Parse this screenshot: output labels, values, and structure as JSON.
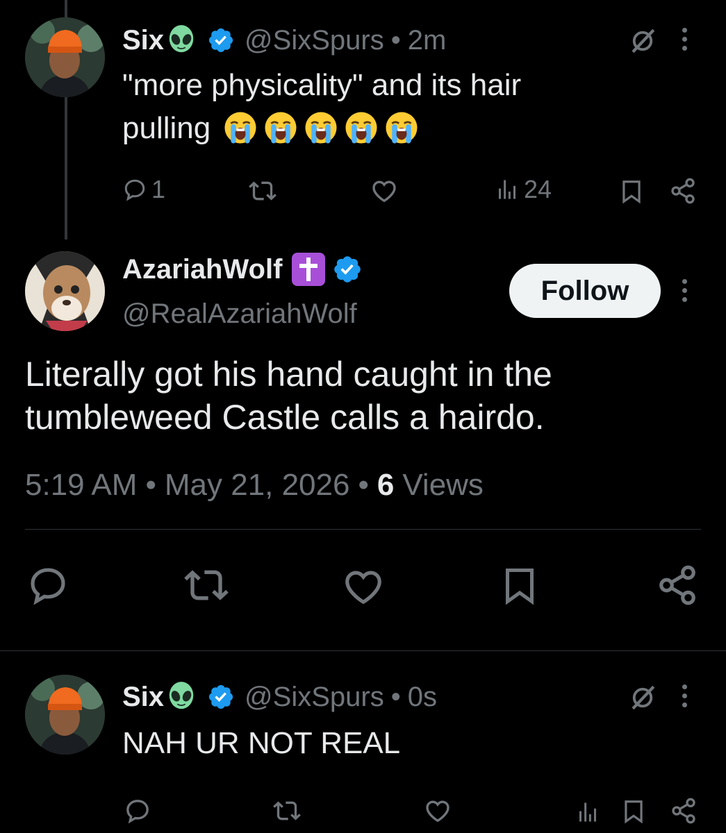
{
  "tweets": [
    {
      "name": "Six",
      "handle": "@SixSpurs",
      "sep": "•",
      "time": "2m",
      "text_line1": "\"more physicality\" and its hair",
      "text_line2": "pulling",
      "emoji_count": 5,
      "replies": "1",
      "views": "24"
    },
    {
      "name": "Six",
      "handle": "@SixSpurs",
      "sep": "•",
      "time": "0s",
      "text": "NAH UR NOT REAL"
    }
  ],
  "main_tweet": {
    "name": "AzariahWolf",
    "handle": "@RealAzariahWolf",
    "follow_label": "Follow",
    "text_line1": "Literally got his hand caught in the",
    "text_line2": "tumbleweed Castle calls a hairdo.",
    "time": "5:19 AM",
    "sep1": "•",
    "date": "May 21, 2026",
    "sep2": "•",
    "views_count": "6",
    "views_label": "Views"
  },
  "icons": {
    "verified": "verified-badge-icon",
    "alien": "alien-emoji-icon",
    "cross": "latin-cross-emoji-icon",
    "grok": "grok-icon",
    "reply": "reply-icon",
    "retweet": "retweet-icon",
    "like": "like-icon",
    "views": "views-icon",
    "bookmark": "bookmark-icon",
    "share": "share-icon",
    "more": "more-icon"
  },
  "colors": {
    "background": "#000000",
    "text": "#e7e9ea",
    "secondary": "#71767b",
    "verified": "#1d9bf0",
    "follow_bg": "#eff3f4"
  }
}
